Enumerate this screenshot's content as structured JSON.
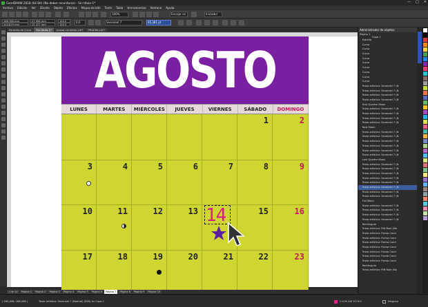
{
  "window": {
    "title": "CorelDRAW 2018 (64 Bit) (No deber recordarse) - Sin título-1*",
    "buttons": [
      "—",
      "□",
      "✕"
    ]
  },
  "menu": [
    "Archivo",
    "Edición",
    "Ver",
    "Diseño",
    "Objeto",
    "Efectos",
    "Mapas de bits",
    "Texto",
    "Tabla",
    "Herramientas",
    "Ventana",
    "Ayuda"
  ],
  "toolbar1": {
    "zoom": "100%",
    "snap": "Encajar en",
    "launch": "Iniciador"
  },
  "toolbar2": {
    "x": "186,768 mm",
    "y": "204,819 mm",
    "w": "27,996 mm",
    "h": "15,327 mm",
    "scale_w": "100,0",
    "scale_h": "100,0",
    "angle": "0,0",
    "font": "Seveneel 7",
    "size": "65,381 pt"
  },
  "doc_tabs": [
    "Pantalla de inicio",
    "Sin título-1*",
    "postal-conteida.cdr*",
    "PRUEBA.cdr*"
  ],
  "calendar": {
    "title": "AGOSTO",
    "days": [
      "LUNES",
      "MARTES",
      "MIÉRCOLES",
      "JUEVES",
      "VIERNES",
      "SÁBADO",
      "DOMINGO"
    ],
    "rows": [
      [
        "",
        "",
        "",
        "",
        "",
        "1",
        "2"
      ],
      [
        "3",
        "4",
        "5",
        "6",
        "7",
        "8",
        "9"
      ],
      [
        "10",
        "11",
        "12",
        "13",
        "14",
        "15",
        "16"
      ],
      [
        "17",
        "18",
        "19",
        "20",
        "21",
        "22",
        "23"
      ]
    ],
    "colors": {
      "purple": "#7b1fa2",
      "lime": "#cfd631",
      "sunday": "#c2185b",
      "star": "#5b1fa0"
    }
  },
  "docker": {
    "title": "Administrador de objetos",
    "page": "Página 1",
    "layer": "Capa 1",
    "items": [
      "Estrella",
      "Curva",
      "Curva",
      "Curva",
      "Curva",
      "Curva",
      "Curva",
      "Curva",
      "Curva",
      "Curva",
      "Texto artístico: Seveneel 7 (N",
      "Texto artístico: Seveneel 7 (N",
      "Texto artístico: Seveneel 7 (N",
      "Texto artístico: Seveneel 7 (N",
      "First Quarter Moon",
      "Texto artístico: Seveneel 7 (N",
      "Texto artístico: Seveneel 7 (N",
      "Texto artístico: Seveneel 7 (N",
      "Texto artístico: Seveneel 7 (N",
      "New Moon",
      "Texto artístico: Seveneel 7 (N",
      "Texto artístico: Seveneel 7 (N",
      "Texto artístico: Seveneel 7 (N",
      "Texto artístico: Seveneel 7 (N",
      "Texto artístico: Seveneel 7 (N",
      "Texto artístico: Seveneel 7 (N",
      "Last Quarter Moon",
      "Texto artístico: Seveneel 7 (N",
      "Texto artístico: Seveneel 7 (N",
      "Texto artístico: Seveneel 7 (N",
      "Texto artístico: Seveneel 7 (N",
      "Texto artístico: Seveneel 7 (N",
      "Texto artístico: Seveneel 7 (N",
      "Texto artístico: Seveneel 7 (N",
      "Texto artístico: Seveneel 7 (N",
      "Full Moon",
      "Texto artístico: Seveneel 7 (N",
      "Texto artístico: Seveneel 7 (N",
      "Texto artístico: Seveneel 7 (N",
      "Texto artístico: Seveneel 7 (N",
      "Rectángulo",
      "Texto artístico: Rift Bold (No",
      "Texto artístico: Flama Cond",
      "Texto artístico: Flama Cond",
      "Texto artístico: Flama Cond",
      "Texto artístico: Flama Cond",
      "Texto artístico: Flama Cond",
      "Texto artístico: Flama Cond",
      "Texto artístico: Flama Cond",
      "Rectángulo",
      "Texto artístico: Rift Bold (No"
    ]
  },
  "page_tabs": [
    "Página 1",
    "Página 2",
    "Página 3",
    "Página 4",
    "Página 5",
    "Página 6",
    "Página 7",
    "Página 8",
    "Página 9",
    "Página 10"
  ],
  "page_nav": "1 de 10",
  "status": {
    "coords": "( 265,806; 166,496 )",
    "object": "Texto artístico: Seveneel 7 (Normal) (ESN) en Capa 1",
    "color": "C:0 M:100 Y:0 K:0",
    "fill": "Ninguno"
  },
  "palette": [
    "#ffffff",
    "#000000",
    "#e53935",
    "#fb8c00",
    "#fdd835",
    "#43a047",
    "#1e88e5",
    "#8e24aa",
    "#ec407a",
    "#26c6da",
    "#8d6e63",
    "#9e9e9e",
    "#cddc39",
    "#ff7043",
    "#5c6bc0",
    "#66bb6a",
    "#ffca28",
    "#ab47bc",
    "#29b6f6",
    "#d4e157",
    "#f06292",
    "#4db6ac",
    "#ffb74d",
    "#7986cb",
    "#aed581",
    "#ba68c8",
    "#4fc3f7",
    "#dce775",
    "#e57373",
    "#81c784",
    "#fff176",
    "#9575cd",
    "#64b5f6",
    "#a1887f",
    "#90a4ae",
    "#ff8a65",
    "#4dd0e1",
    "#f48fb1",
    "#c5e1a5",
    "#b39ddb"
  ]
}
